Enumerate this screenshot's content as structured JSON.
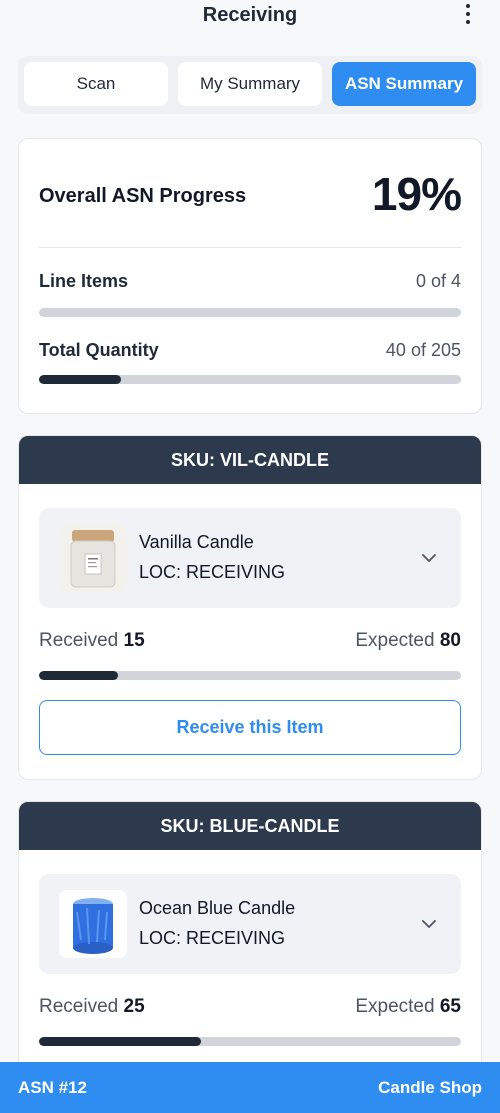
{
  "header": {
    "title": "Receiving",
    "menu_icon": "kebab-menu-icon"
  },
  "tabs": [
    {
      "label": "Scan",
      "active": false
    },
    {
      "label": "My Summary",
      "active": false
    },
    {
      "label": "ASN Summary",
      "active": true
    }
  ],
  "overall": {
    "title": "Overall ASN Progress",
    "percent": "19%",
    "line_items": {
      "label": "Line Items",
      "value": "0 of 4",
      "progress": 0.0
    },
    "total_quantity": {
      "label": "Total Quantity",
      "value": "40 of 205",
      "progress": 0.195
    }
  },
  "items": [
    {
      "sku_header": "SKU: VIL-CANDLE",
      "name": "Vanilla Candle",
      "location": "LOC: RECEIVING",
      "received_label": "Received",
      "received": "15",
      "expected_label": "Expected",
      "expected": "80",
      "progress": 0.1875,
      "button_label": "Receive this Item",
      "thumb_icon": "vanilla-candle-image"
    },
    {
      "sku_header": "SKU: BLUE-CANDLE",
      "name": "Ocean Blue Candle",
      "location": "LOC: RECEIVING",
      "received_label": "Received",
      "received": "25",
      "expected_label": "Expected",
      "expected": "65",
      "progress": 0.385,
      "thumb_icon": "blue-candle-image"
    }
  ],
  "footer": {
    "asn": "ASN #12",
    "shop": "Candle Shop"
  },
  "colors": {
    "primary": "#2f8df2",
    "dark": "#2d3a4d",
    "track": "#d1d5db",
    "fill": "#1f2937"
  }
}
